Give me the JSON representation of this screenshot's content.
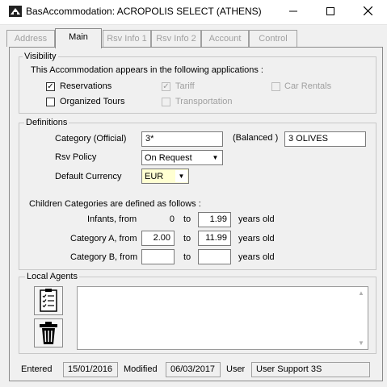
{
  "window": {
    "title": "BasAccommodation: ACROPOLIS SELECT (ATHENS)"
  },
  "tabs": [
    {
      "label": "Address",
      "active": false
    },
    {
      "label": "Main",
      "active": true
    },
    {
      "label": "Rsv Info 1",
      "active": false
    },
    {
      "label": "Rsv Info 2",
      "active": false
    },
    {
      "label": "Account",
      "active": false
    },
    {
      "label": "Control",
      "active": false
    }
  ],
  "visibility": {
    "legend": "Visibility",
    "description": "This Accommodation appears in the following applications :",
    "options": [
      {
        "label": "Reservations",
        "checked": true,
        "enabled": true
      },
      {
        "label": "Tariff",
        "checked": true,
        "enabled": false
      },
      {
        "label": "Car Rentals",
        "checked": false,
        "enabled": false
      },
      {
        "label": "Organized Tours",
        "checked": false,
        "enabled": true
      },
      {
        "label": "Transportation",
        "checked": false,
        "enabled": false
      }
    ]
  },
  "definitions": {
    "legend": "Definitions",
    "category_label": "Category (Official)",
    "category_value": "3*",
    "balanced_label": "(Balanced )",
    "balanced_value": "3 OLIVES",
    "rsv_policy_label": "Rsv Policy",
    "rsv_policy_value": "On Request",
    "currency_label": "Default Currency",
    "currency_value": "EUR",
    "children_intro": "Children Categories are defined as follows :",
    "to_label": "to",
    "years_label": "years old",
    "children": [
      {
        "label": "Infants, from",
        "from": "0",
        "to": "1.99"
      },
      {
        "label": "Category A, from",
        "from": "2.00",
        "to": "11.99"
      },
      {
        "label": "Category B, from",
        "from": "",
        "to": ""
      }
    ]
  },
  "local_agents": {
    "legend": "Local Agents",
    "notes": ""
  },
  "footer": {
    "entered_label": "Entered",
    "entered_value": "15/01/2016",
    "modified_label": "Modified",
    "modified_value": "06/03/2017",
    "user_label": "User",
    "user_value": "User Support 3S"
  },
  "colors": {
    "titlebar": "#ffffff",
    "window_bg": "#f0f0f0",
    "field_bg": "#ffffff",
    "currency_bg": "#ffffd2",
    "disabled_text": "#a0a0a0"
  },
  "icons": [
    "app-icon",
    "minimize-icon",
    "maximize-icon",
    "close-icon",
    "checklist-icon",
    "trash-icon",
    "scroll-up-icon",
    "scroll-down-icon"
  ]
}
